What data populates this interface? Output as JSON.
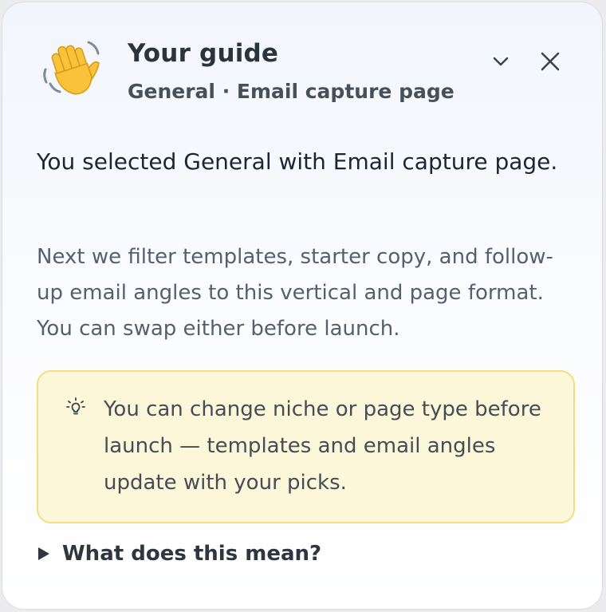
{
  "guide": {
    "icon": "waving-hand-icon",
    "title": "Your guide",
    "subtitle": "General · Email capture page",
    "controls": {
      "collapse_icon": "chevron-down-icon",
      "close_icon": "close-icon"
    }
  },
  "content": {
    "lead": "You selected General with Email capture page.",
    "body": "Next we filter templates, starter copy, and follow-up email angles to this vertical and page format. You can swap either before launch."
  },
  "tip": {
    "icon": "lightbulb-icon",
    "text": "You can change niche or page type before launch — templates and email angles update with your picks."
  },
  "disclosure": {
    "icon": "caret-right-icon",
    "label": "What does this mean?"
  },
  "colors": {
    "tip_background": "#fdf7d9",
    "tip_border": "#f2dc86",
    "hand": "#f8c23a"
  }
}
